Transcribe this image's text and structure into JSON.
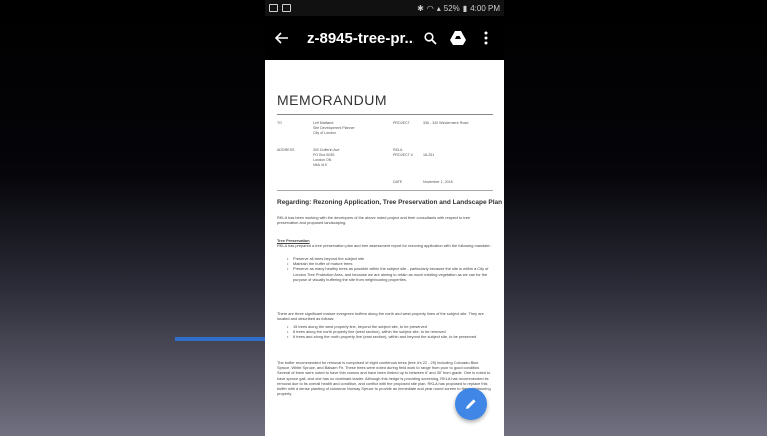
{
  "status_bar": {
    "battery": "52%",
    "time": "4:00 PM"
  },
  "app_bar": {
    "back_icon": "arrow-left-icon",
    "title": "z-8945-tree-pr...",
    "search_icon": "search-icon",
    "drive_icon": "google-drive-icon",
    "more_icon": "more-vertical-icon"
  },
  "document": {
    "title": "MEMORANDUM",
    "to_label": "TO",
    "to_value_1": "Leif Maitland",
    "to_value_2": "Site Development Planner",
    "to_value_3": "City of London",
    "project_label": "PROJECT",
    "project_value": "336 - 342 Windermere Road",
    "address_label": "ADDRESS",
    "address_1": "300 Dufferin Ave",
    "address_2": "PO Box 5035",
    "address_3": "London ON",
    "address_4": "N6A 4L9",
    "rmla_label": "RKLA",
    "project_no_label": "PROJECT #",
    "project_no_value": "18-251",
    "date_label": "DATE",
    "date_value": "November 1, 2018",
    "regarding": "Regarding:  Rezoning Application, Tree Preservation and Landscape Plan",
    "intro": "RKLA has been working with the developers of the above noted project and their consultants with respect to tree preservation and proposed landscaping.",
    "tree_heading": "Tree Preservation",
    "tree_para": "RKLA has prepared a tree preservation plan and tree assessment report for rezoning application with the following mandate:",
    "bullets1": [
      "Preserve all trees beyond the subject site",
      "Maintain the buffer of mature trees",
      "Preserve as many healthy trees as possible within the subject site - particularly because the site is within a City of London Tree Protection Area, and because we are aiming to retain as much existing vegetation as we can for the purpose of visually buffering the site from neighbouring properties."
    ],
    "buffer_para": "There are three significant mature evergreen buffers along the north and west property lines of the subject site. They are located and described as follows:",
    "bullets2": [
      "15 trees along the west property line, beyond the subject site, to be preserved",
      "8 trees along the north property line (west section), within the subject site, to be removed",
      "6 trees and along the north property line (east section), within and beyond the subject site, to be preserved"
    ],
    "removal_para": "The buffer recommended for removal is comprised of eight coniferous trees (tree #'s 22 - 29) including Colorado Blue Spruce, White Spruce, and Balsam Fir. These trees were noted during field work to range from poor to good condition. Several of them were noted to have thin crowns and have been limbed up to between 6' and 30' from grade. One is noted to have spruce gall, and one has no dominant leader. Although this hedge is providing screening, RKLA has recommended its removal due to its overall health and condition, and conflict with the proposed site plan. RKLA has proposed to replace this buffer with a dense planting of columnar Norway Spruce to provide an immediate and year round screen to the neighbouring property."
  },
  "fab_icon": "edit-pencil-icon",
  "annotation_arrow": "arrow-right-icon",
  "colors": {
    "fab": "#3f86e6",
    "arrow": "#2f6fc9",
    "app_bar": "#000000"
  }
}
